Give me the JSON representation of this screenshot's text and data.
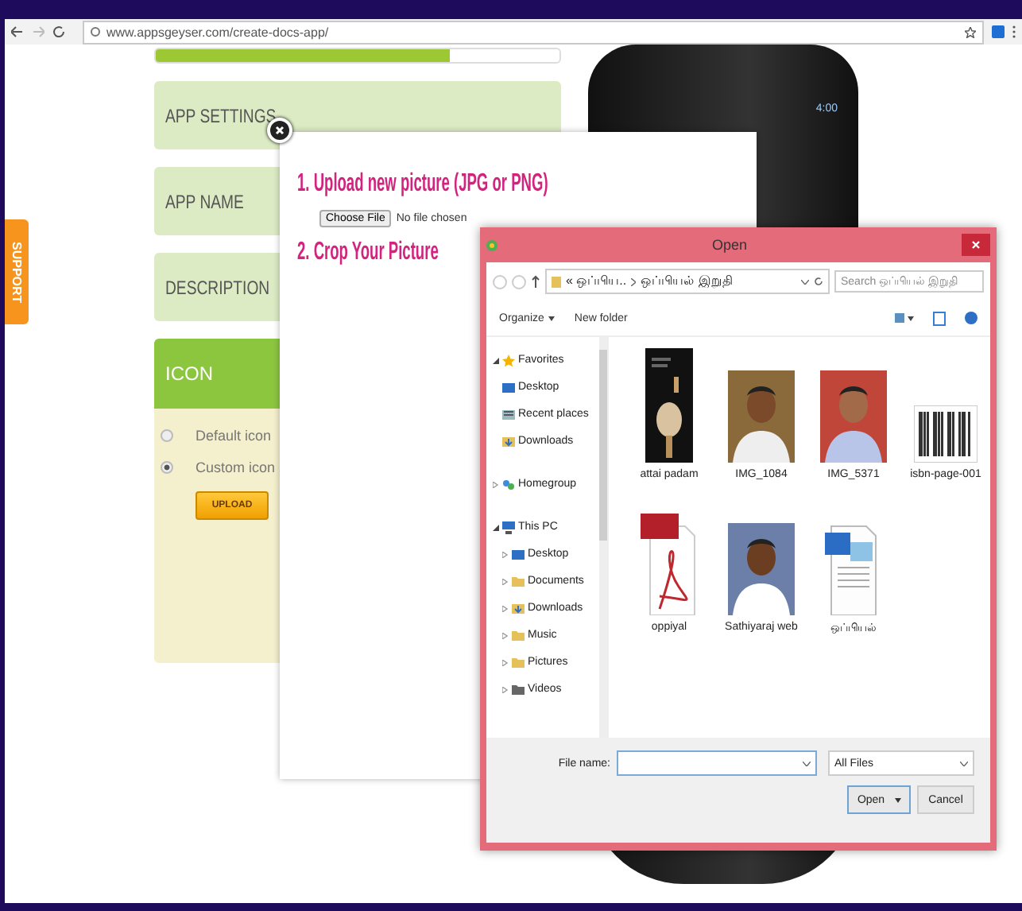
{
  "browser": {
    "url": "www.appsgeyser.com/create-docs-app/"
  },
  "page": {
    "support_tab": "SUPPORT",
    "progress": {
      "level": 0.73
    },
    "sections": [
      {
        "label": "APP SETTINGS"
      },
      {
        "label": "APP NAME"
      },
      {
        "label": "DESCRIPTION"
      }
    ],
    "icon_section": {
      "title": "ICON",
      "options": [
        {
          "label": "Default icon",
          "selected": false
        },
        {
          "label": "Custom icon",
          "selected": true
        }
      ],
      "upload_button": "UPLOAD"
    },
    "phone": {
      "time": "4:00"
    }
  },
  "modal": {
    "step1": "1. Upload new picture (JPG or PNG)",
    "choose_file": "Choose File",
    "file_status": "No file chosen",
    "step2": "2. Crop Your Picture"
  },
  "dialog": {
    "title": "Open",
    "breadcrumbs": [
      "« ஒப்பிய..",
      "ஒப்பியல் இறுதி"
    ],
    "search_placeholder": "Search ஒப்பியல் இறுதி",
    "toolbar": [
      {
        "label": "Organize",
        "kind": "menu"
      },
      {
        "label": "New folder",
        "kind": "button"
      }
    ],
    "nav": [
      {
        "label": "Favorites",
        "kind": "star",
        "expanded": true,
        "children": [
          {
            "label": "Desktop",
            "kind": "desktop"
          },
          {
            "label": "Recent places",
            "kind": "recent"
          },
          {
            "label": "Downloads",
            "kind": "download"
          }
        ]
      },
      {
        "label": "Homegroup",
        "kind": "network",
        "expanded": false
      },
      {
        "label": "This PC",
        "kind": "computer",
        "expanded": true,
        "children": [
          {
            "label": "Desktop",
            "kind": "desktop",
            "expanded": false
          },
          {
            "label": "Documents",
            "kind": "folder",
            "expanded": false
          },
          {
            "label": "Downloads",
            "kind": "download",
            "expanded": false
          },
          {
            "label": "Music",
            "kind": "folder",
            "expanded": false
          },
          {
            "label": "Pictures",
            "kind": "folder",
            "expanded": false
          },
          {
            "label": "Videos",
            "kind": "video",
            "expanded": false
          }
        ]
      }
    ],
    "files": [
      {
        "name": "attai padam",
        "kind": "cover"
      },
      {
        "name": "IMG_1084"
      },
      {
        "name": "IMG_5371"
      },
      {
        "name": "isbn-page-001",
        "kind": "barcode"
      },
      {
        "name": "oppiyal",
        "kind": "pdf"
      },
      {
        "name": "Sathiyaraj web"
      },
      {
        "name": "ஒப்பியல்",
        "kind": "document"
      }
    ],
    "file_name_label": "File name:",
    "file_type": "All Files",
    "open_button": "Open",
    "cancel_button": "Cancel"
  }
}
